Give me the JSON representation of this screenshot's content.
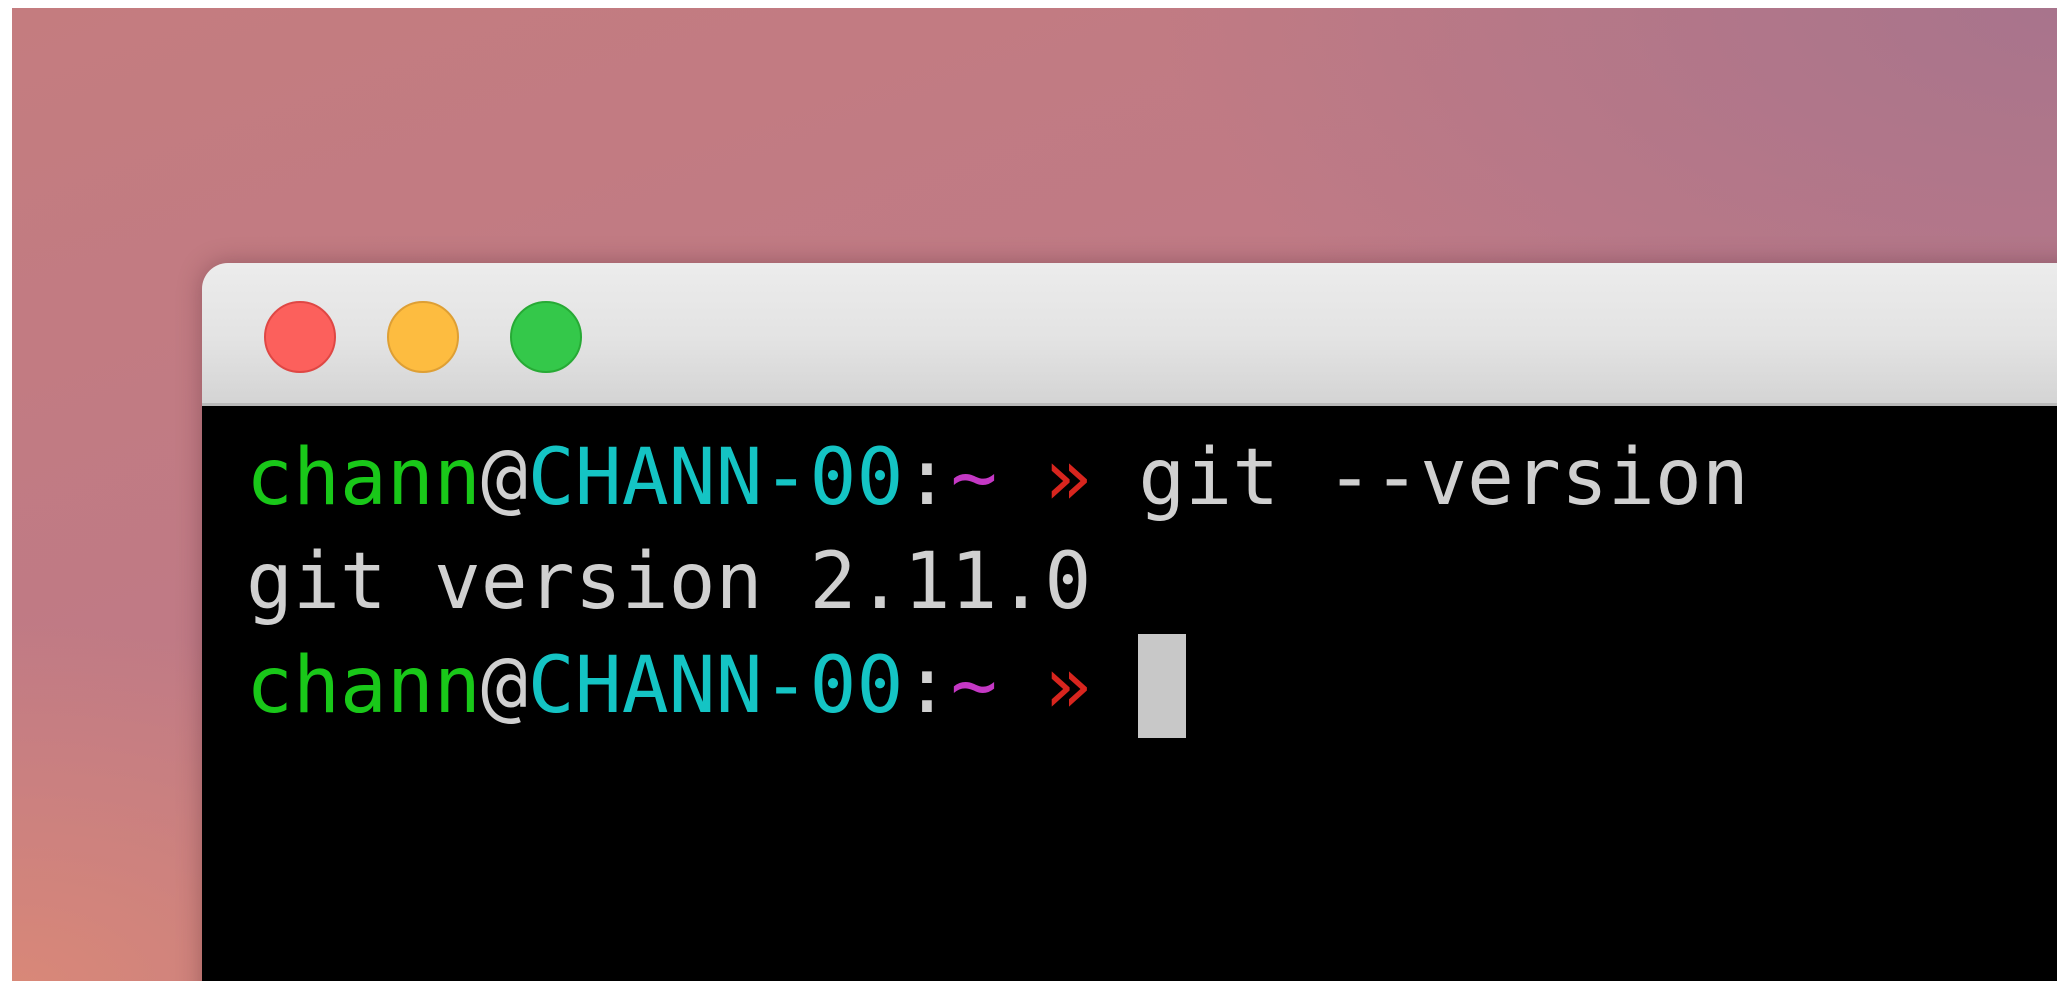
{
  "window": {
    "controls": {
      "close_color": "#fc605c",
      "minimize_color": "#fdbc40",
      "zoom_color": "#34c84a"
    }
  },
  "terminal": {
    "prompt": {
      "user": "chann",
      "at": "@",
      "host": "CHANN-00",
      "colon": ":",
      "path": "~",
      "symbol": "»"
    },
    "lines": [
      {
        "type": "prompt",
        "command": "git --version"
      },
      {
        "type": "output",
        "text": "git version 2.11.0"
      },
      {
        "type": "prompt",
        "command": ""
      }
    ],
    "colors": {
      "user": "#19c819",
      "host": "#14c4c4",
      "path": "#c438c4",
      "symbol": "#d8251e",
      "text": "#d0d0d0",
      "background": "#000000"
    }
  }
}
